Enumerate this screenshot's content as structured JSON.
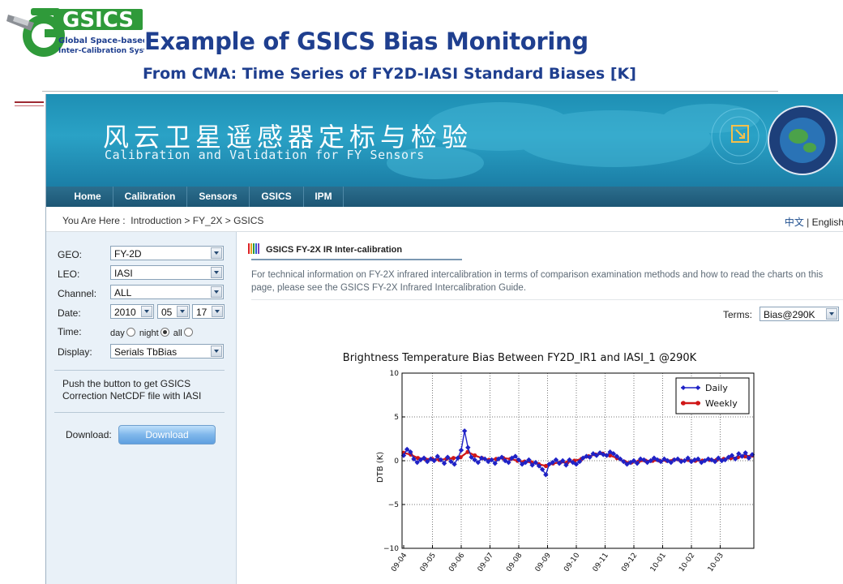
{
  "slide": {
    "logo_text": "GSICS",
    "logo_sub1": "Global Space-based",
    "logo_sub2": "Inter-Calibration System",
    "title": "Example of GSICS Bias Monitoring",
    "subtitle": "From CMA: Time Series of FY2D-IASI Standard Biases [K]"
  },
  "banner": {
    "title_cn": "风云卫星遥感器定标与检验",
    "title_en": "Calibration and Validation for FY Sensors"
  },
  "nav": {
    "items": [
      "Home",
      "Calibration",
      "Sensors",
      "GSICS",
      "IPM"
    ]
  },
  "breadcrumb": {
    "prefix": "You Are Here :",
    "items": [
      "Introduction",
      "FY_2X",
      "GSICS"
    ],
    "separator": ">",
    "lang_cn": "中文",
    "lang_sep": "|",
    "lang_en": "English"
  },
  "form": {
    "geo_label": "GEO:",
    "geo_value": "FY-2D",
    "leo_label": "LEO:",
    "leo_value": "IASI",
    "channel_label": "Channel:",
    "channel_value": "ALL",
    "date_label": "Date:",
    "date_year": "2010",
    "date_month": "05",
    "date_day": "17",
    "time_label": "Time:",
    "time_day": "day",
    "time_night": "night",
    "time_all": "all",
    "time_selected": "night",
    "display_label": "Display:",
    "display_value": "Serials TbBias",
    "note": "Push the button to get GSICS Correction NetCDF file with IASI",
    "download_label": "Download:",
    "download_button": "Download"
  },
  "main": {
    "panel_title": "GSICS FY-2X IR Inter-calibration",
    "info": "For technical information on FY-2X infrared intercalibration in terms of comparison examination methods and how to read the charts on this page, please see the GSICS FY-2X Infrared Intercalibration Guide.",
    "terms_label": "Terms:",
    "terms_value": "Bias@290K"
  },
  "chart_data": {
    "type": "line",
    "title": "Brightness Temperature Bias Between FY2D_IR1 and IASI_1 @290K",
    "xlabel": "",
    "ylabel": "DTB (K)",
    "ylim": [
      -10,
      10
    ],
    "yticks": [
      10,
      5,
      0,
      -5,
      -10
    ],
    "xticks": [
      "09-04",
      "09-05",
      "09-06",
      "09-07",
      "09-08",
      "09-09",
      "09-10",
      "09-11",
      "09-12",
      "10-01",
      "10-02",
      "10-03"
    ],
    "grid": true,
    "legend": "top-right",
    "series": [
      {
        "name": "Daily",
        "color": "#1f22c6",
        "marker": "diamond",
        "values": [
          0.6,
          1.3,
          1.0,
          0.2,
          -0.2,
          0.1,
          0.3,
          -0.1,
          0.2,
          0.0,
          0.5,
          0.1,
          -0.3,
          0.4,
          -0.1,
          -0.4,
          0.3,
          1.2,
          3.4,
          1.5,
          0.4,
          0.1,
          -0.2,
          0.3,
          0.2,
          -0.1,
          0.1,
          -0.3,
          0.2,
          0.4,
          0.0,
          -0.2,
          0.3,
          0.5,
          0.1,
          -0.4,
          -0.2,
          0.1,
          -0.5,
          -0.2,
          -0.6,
          -1.0,
          -1.6,
          -0.4,
          -0.2,
          0.1,
          -0.3,
          0.0,
          -0.5,
          0.1,
          -0.2,
          -0.4,
          -0.1,
          0.3,
          0.5,
          0.4,
          0.8,
          0.6,
          0.9,
          0.7,
          0.6,
          1.0,
          0.8,
          0.5,
          0.2,
          -0.1,
          -0.4,
          -0.2,
          0.0,
          -0.3,
          0.2,
          0.1,
          -0.2,
          0.0,
          0.3,
          0.1,
          -0.1,
          0.2,
          0.0,
          -0.2,
          0.1,
          0.2,
          -0.1,
          0.0,
          0.3,
          -0.1,
          0.1,
          0.2,
          -0.2,
          0.0,
          0.2,
          0.1,
          -0.1,
          0.3,
          0.0,
          0.1,
          0.4,
          0.6,
          0.2,
          0.8,
          0.5,
          0.9,
          0.3,
          0.7
        ]
      },
      {
        "name": "Weekly",
        "color": "#d01818",
        "marker": "circle",
        "values": [
          0.9,
          0.7,
          0.3,
          0.2,
          0.2,
          0.1,
          0.2,
          0.3,
          0.4,
          1.0,
          0.6,
          0.3,
          0.1,
          0.2,
          0.3,
          0.2,
          0.0,
          -0.1,
          -0.2,
          -0.4,
          -0.6,
          -0.3,
          -0.2,
          -0.2,
          0.0,
          0.2,
          0.5,
          0.7,
          0.8,
          0.6,
          0.3,
          -0.1,
          -0.2,
          -0.1,
          0.0,
          0.0,
          0.0,
          0.0,
          0.1,
          0.0,
          0.1,
          0.0,
          0.0,
          0.1,
          0.1,
          0.2,
          0.3,
          0.4,
          0.5,
          0.6
        ]
      }
    ]
  }
}
